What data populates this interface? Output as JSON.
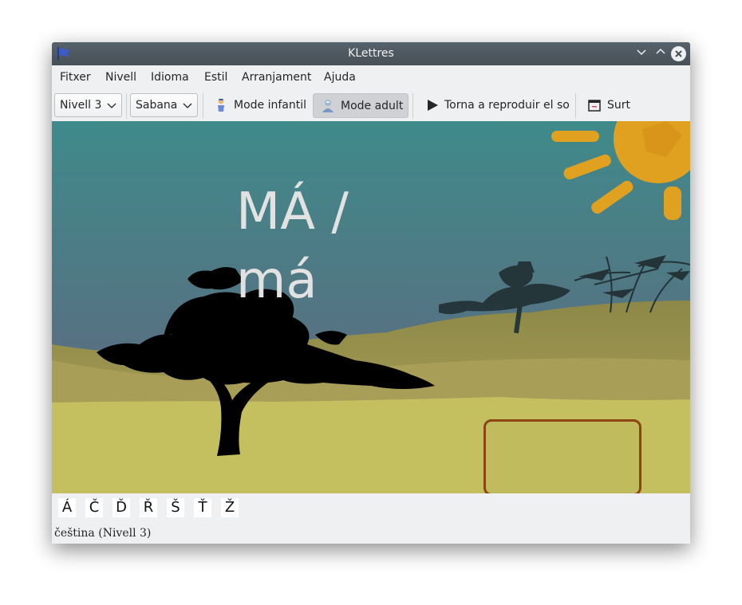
{
  "window": {
    "title": "KLettres"
  },
  "menubar": {
    "items": [
      "Fitxer",
      "Nivell",
      "Idioma",
      "Estil",
      "Arranjament",
      "Ajuda"
    ]
  },
  "toolbar": {
    "level_combo": "Nivell 3",
    "theme_combo": "Sabana",
    "kid_mode_label": "Mode infantil",
    "adult_mode_label": "Mode adult",
    "replay_label": "Torna a reproduir el so",
    "quit_label": "Surt"
  },
  "game": {
    "word_upper": "MÁ /",
    "word_lower": "má",
    "answer_value": ""
  },
  "special_letters": [
    "Á",
    "Č",
    "Ď",
    "Ř",
    "Š",
    "Ť",
    "Ž"
  ],
  "status": {
    "text": "čeština  (Nivell 3)"
  },
  "colors": {
    "sky_top": "#3f8a8a",
    "sky_bottom": "#5c7280",
    "ground": "#c4c060",
    "sun": "#e0a020",
    "answer_border": "#8b4513"
  },
  "icons": {
    "app": "klettres-flag-icon",
    "kid_mode": "kid-mode-icon",
    "adult_mode": "adult-mode-icon",
    "replay": "play-icon",
    "quit": "quit-icon"
  }
}
